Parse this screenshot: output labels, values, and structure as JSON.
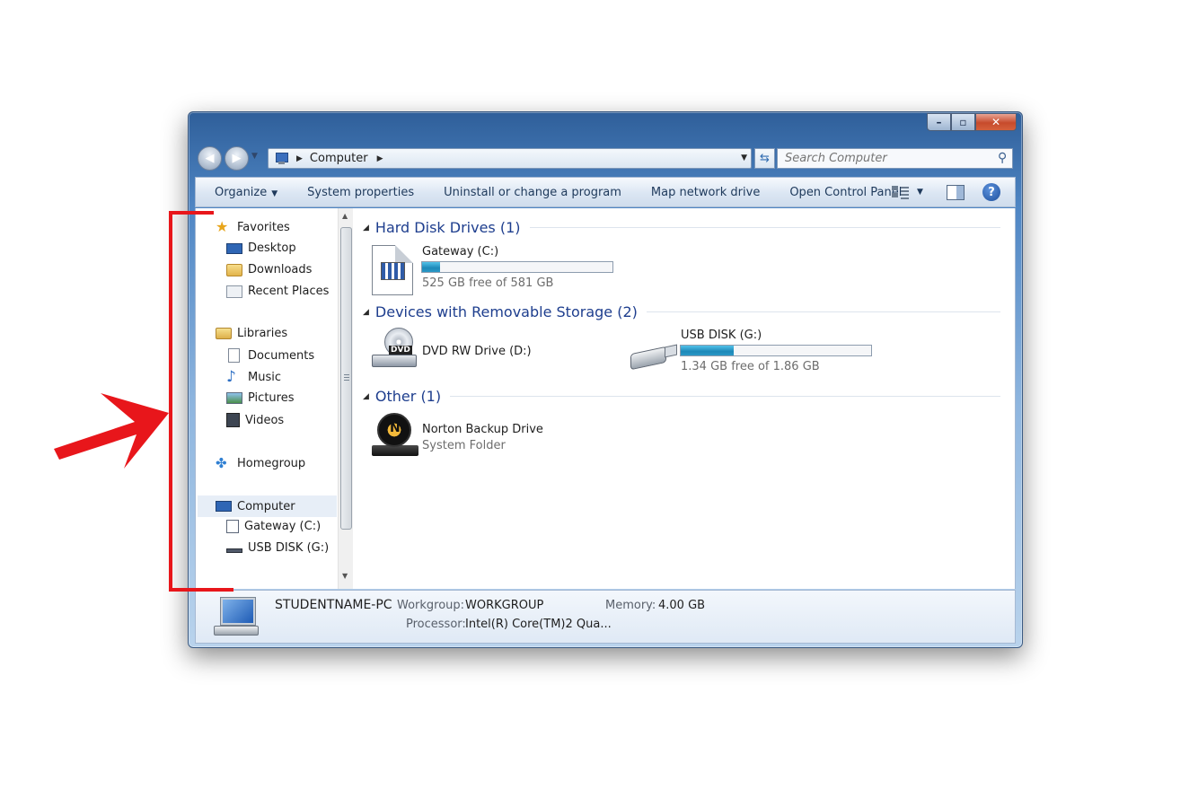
{
  "window": {
    "caption_buttons": {
      "minimize_icon": "minimize-icon",
      "maximize_icon": "maximize-icon",
      "close_icon": "close-icon"
    }
  },
  "address_bar": {
    "breadcrumbs": [
      "Computer"
    ],
    "search_placeholder": "Search Computer"
  },
  "toolbar": {
    "organize": "Organize",
    "system_properties": "System properties",
    "uninstall": "Uninstall or change a program",
    "map_network_drive": "Map network drive",
    "open_control_panel": "Open Control Panel"
  },
  "sidebar": {
    "favorites": {
      "label": "Favorites",
      "items": [
        "Desktop",
        "Downloads",
        "Recent Places"
      ]
    },
    "libraries": {
      "label": "Libraries",
      "items": [
        "Documents",
        "Music",
        "Pictures",
        "Videos"
      ]
    },
    "homegroup": "Homegroup",
    "computer": {
      "label": "Computer",
      "items": [
        "Gateway (C:)",
        "USB DISK (G:)"
      ]
    }
  },
  "groups": {
    "hdd": {
      "title": "Hard Disk Drives (1)",
      "items": [
        {
          "name": "Gateway (C:)",
          "free_text": "525 GB free of 581 GB",
          "used_fraction": 0.096,
          "icon": "hard-drive-icon"
        }
      ]
    },
    "removable": {
      "title": "Devices with Removable Storage (2)",
      "items": [
        {
          "name": "DVD RW Drive (D:)",
          "icon": "dvd-drive-icon"
        },
        {
          "name": "USB DISK (G:)",
          "free_text": "1.34 GB free of 1.86 GB",
          "used_fraction": 0.28,
          "icon": "usb-drive-icon"
        }
      ]
    },
    "other": {
      "title": "Other (1)",
      "items": [
        {
          "name": "Norton Backup Drive",
          "type": "System Folder",
          "icon": "norton-backup-icon"
        }
      ]
    }
  },
  "details": {
    "pc_name": "STUDENTNAME-PC",
    "workgroup_label": "Workgroup:",
    "workgroup_value": "WORKGROUP",
    "memory_label": "Memory:",
    "memory_value": "4.00 GB",
    "processor_label": "Processor:",
    "processor_value": "Intel(R) Core(TM)2 Qua..."
  },
  "colors": {
    "annotation_red": "#e8161b",
    "group_title": "#1e3e8e",
    "capacity_fill": "#1d88b8",
    "window_frame": "#4f86c4"
  }
}
